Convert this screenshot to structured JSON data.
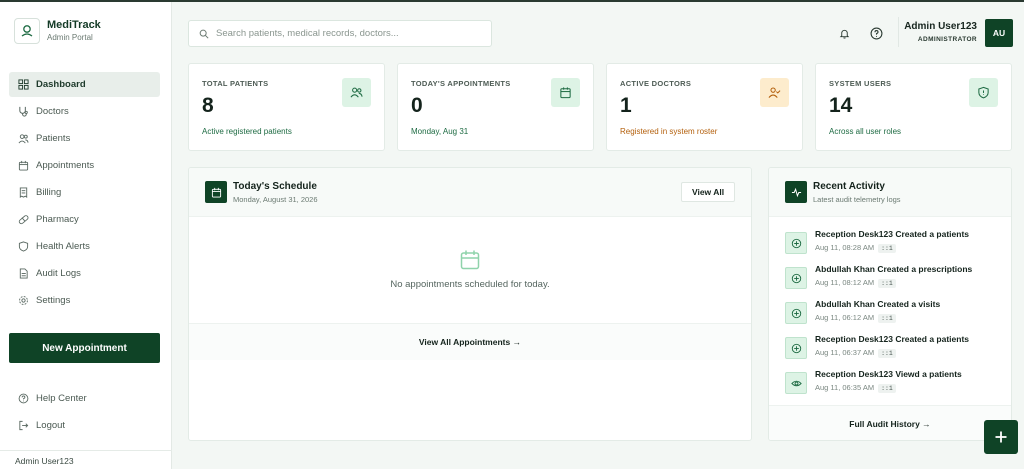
{
  "brand": {
    "name": "MediTrack",
    "subtitle": "Admin Portal"
  },
  "sidebar": {
    "items": [
      {
        "label": "Dashboard",
        "icon": "grid-icon",
        "active": true
      },
      {
        "label": "Doctors",
        "icon": "stethoscope-icon"
      },
      {
        "label": "Patients",
        "icon": "users-icon"
      },
      {
        "label": "Appointments",
        "icon": "calendar-icon"
      },
      {
        "label": "Billing",
        "icon": "receipt-icon"
      },
      {
        "label": "Pharmacy",
        "icon": "pill-icon"
      },
      {
        "label": "Health Alerts",
        "icon": "shield-icon"
      },
      {
        "label": "Audit Logs",
        "icon": "file-icon"
      },
      {
        "label": "Settings",
        "icon": "gear-icon"
      }
    ],
    "new_appointment_label": "New Appointment",
    "help_label": "Help Center",
    "logout_label": "Logout",
    "footer_user": "Admin User123"
  },
  "header": {
    "search_placeholder": "Search patients, medical records, doctors...",
    "user_name": "Admin User123",
    "user_role": "ADMINISTRATOR",
    "avatar_initials": "AU"
  },
  "stats": [
    {
      "label": "TOTAL PATIENTS",
      "value": "8",
      "sub": "Active registered patients",
      "icon": "users-icon",
      "tone": "green"
    },
    {
      "label": "TODAY'S APPOINTMENTS",
      "value": "0",
      "sub": "Monday, Aug 31",
      "icon": "calendar-icon",
      "tone": "green"
    },
    {
      "label": "ACTIVE DOCTORS",
      "value": "1",
      "sub": "Registered in system roster",
      "icon": "user-check-icon",
      "tone": "orange"
    },
    {
      "label": "SYSTEM USERS",
      "value": "14",
      "sub": "Across all user roles",
      "icon": "shield-icon",
      "tone": "green"
    }
  ],
  "schedule": {
    "title": "Today's Schedule",
    "date": "Monday, August 31, 2026",
    "view_all_label": "View All",
    "empty_text": "No appointments scheduled for today.",
    "footer_link": "View All Appointments →"
  },
  "activity": {
    "title": "Recent Activity",
    "subtitle": "Latest audit telemetry logs",
    "items": [
      {
        "text": "Reception Desk123 Created a patients",
        "time": "Aug 11, 08:28 AM",
        "chip": "::1",
        "icon": "plus-circle-icon"
      },
      {
        "text": "Abdullah Khan Created a prescriptions",
        "time": "Aug 11, 08:12 AM",
        "chip": "::1",
        "icon": "plus-circle-icon"
      },
      {
        "text": "Abdullah Khan Created a visits",
        "time": "Aug 11, 06:12 AM",
        "chip": "::1",
        "icon": "plus-circle-icon"
      },
      {
        "text": "Reception Desk123 Created a patients",
        "time": "Aug 11, 06:37 AM",
        "chip": "::1",
        "icon": "plus-circle-icon"
      },
      {
        "text": "Reception Desk123 Viewd a patients",
        "time": "Aug 11, 06:35 AM",
        "chip": "::1",
        "icon": "eye-icon"
      }
    ],
    "footer_link": "Full Audit History →"
  },
  "colors": {
    "brand": "#0f4326",
    "accent_bg": "#ddf3e5",
    "warn": "#b35f0b"
  }
}
